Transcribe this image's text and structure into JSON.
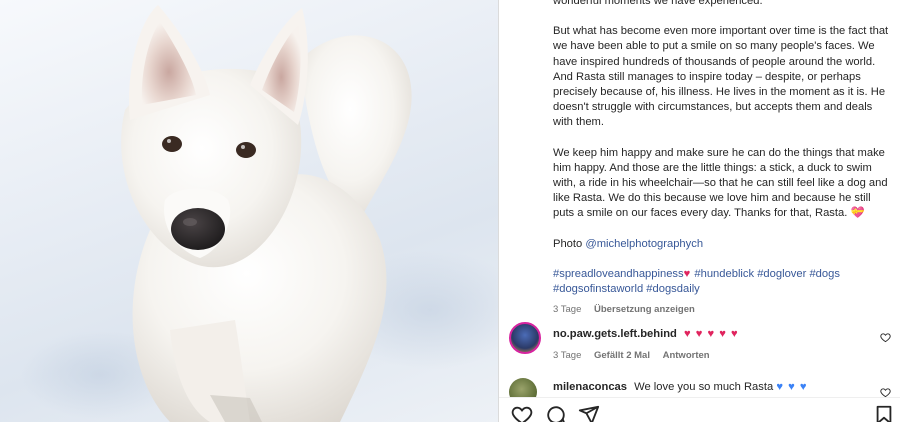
{
  "caption": {
    "line_top": "wonderful moments we have experienced.",
    "para1": "But what has become even more important over time is the fact that we have been able to put a smile on so many people's faces. We have inspired hundreds of thousands of people around the world. And Rasta still manages to inspire today – despite, or perhaps precisely because of, his illness. He lives in the moment as it is. He doesn't struggle with circumstances, but accepts them and deals with them.",
    "para2": "We keep him happy and make sure he can do the things that make him happy. And those are the little things: a stick, a duck to swim with, a ride in his wheelchair—so that he can still feel like a dog and like Rasta. We do this because we love him and because he still puts a smile on our faces every day. Thanks for that, Rasta.",
    "para2_emoji": "💝",
    "photo_label": "Photo",
    "photo_credit": "@michelphotographych",
    "hashtags_line1": "#spreadloveandhappiness",
    "hashtags_line1_emoji": "♥",
    "hashtags_line1_rest": "#hundeblick #doglover #dogs",
    "hashtags_line2": "#dogsofinstaworld #dogsdaily",
    "time": "3 Tage",
    "translate": "Übersetzung anzeigen"
  },
  "comments": [
    {
      "user": "no.paw.gets.left.behind",
      "text": "♥ ♥ ♥ ♥ ♥",
      "time": "3 Tage",
      "likes": "Gefällt 2 Mal",
      "reply": "Antworten"
    },
    {
      "user": "milenaconcas",
      "text": "We love you so much Rasta",
      "emoji": "♥ ♥ ♥"
    }
  ],
  "icons": {
    "like": "heart-icon",
    "comment": "comment-icon",
    "share": "share-icon",
    "save": "bookmark-icon"
  },
  "colors": {
    "link": "#385898",
    "meta": "#737373",
    "heart": "#e0245e",
    "blue_heart": "#3b82f6"
  }
}
